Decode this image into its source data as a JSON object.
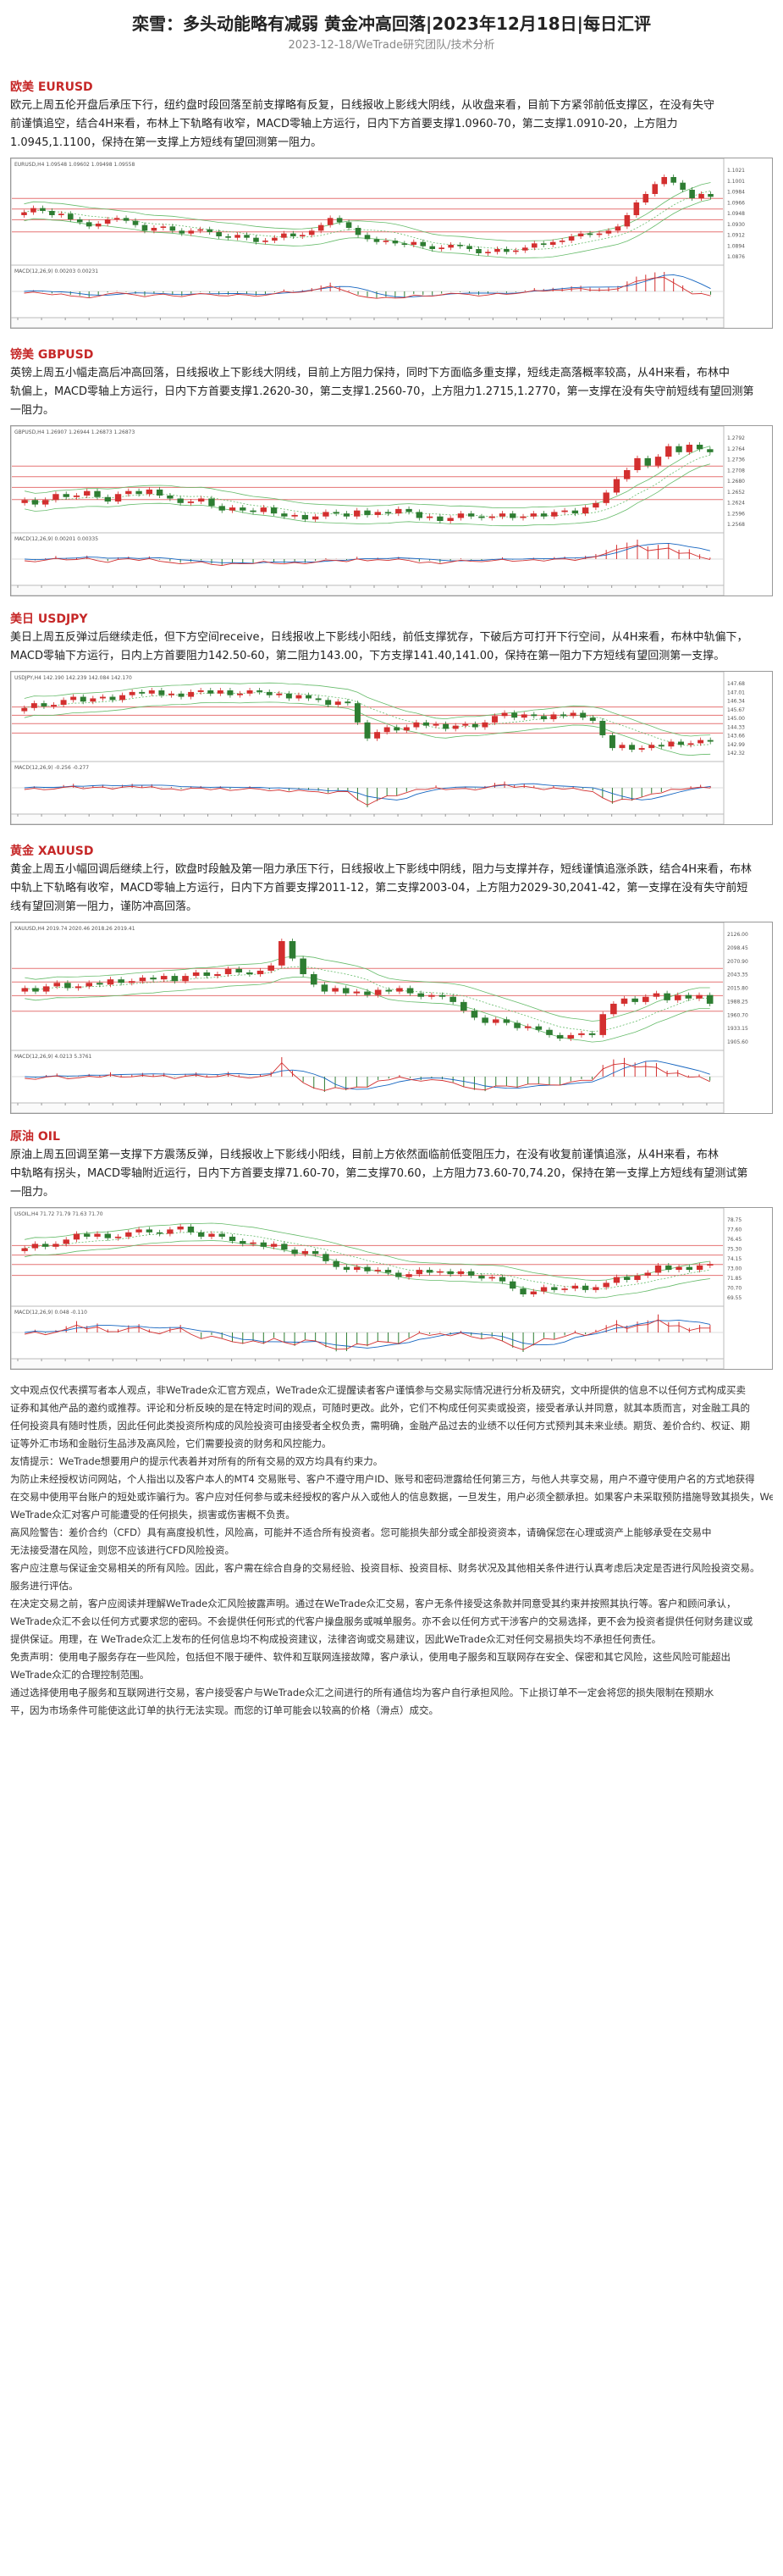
{
  "header": {
    "title": "栾雪：多头动能略有减弱 黄金冲高回落|2023年12月18日|每日汇评",
    "subtitle": "2023-12-18/WeTrade研究团队/技术分析"
  },
  "sections": [
    {
      "title": "欧美 EURUSD",
      "lines": [
        "欧元上周五伦开盘后承压下行，纽约盘时段回落至前支撑略有反复，日线报收上影线大阴线，从收盘来看，目前下方紧邻前低支撑区，在没有失守",
        "前谨慎追空，结合4H来看，布林上下轨略有收窄，MACD零轴上方运行，日内下方首要支撑1.0960-70，第二支撑1.0910-20，上方阻力",
        "1.0945,1.1100，保持在第一支撑上方短线有望回测第一阻力。"
      ],
      "chart_label": "EURUSD,H4 1.09548 1.09602 1.09498 1.09558",
      "macd_label": "MACD(12,26,9) 0.00203 0.00231",
      "price_ticks": [
        "1.1021",
        "1.1001",
        "1.0984",
        "1.0966",
        "1.0948",
        "1.0930",
        "1.0912",
        "1.0894",
        "1.0876"
      ],
      "candles": [
        2,
        3,
        -2,
        -3,
        1,
        -4,
        -2,
        -3,
        2,
        3,
        1,
        -2,
        -3,
        -4,
        2,
        1,
        -3,
        -2,
        2,
        1,
        -2,
        -3,
        -1,
        2,
        -2,
        -3,
        1,
        2,
        3,
        -2,
        1,
        3,
        4,
        5,
        -3,
        -4,
        -5,
        -3,
        -2,
        1,
        -2,
        -1,
        2,
        -3,
        -2,
        1,
        2,
        -1,
        -2,
        -3,
        1,
        2,
        -2,
        1,
        2,
        3,
        -1,
        2,
        1,
        3,
        2,
        -1,
        1,
        2,
        3,
        8,
        9,
        6,
        7,
        5,
        -4,
        -5,
        -6,
        3,
        -2
      ]
    },
    {
      "title": "镑美 GBPUSD",
      "lines": [
        "英镑上周五小幅走高后冲高回落，日线报收上下影线大阴线，目前上方阻力保持，同时下方面临多重支撑，短线走高落概率较高，从4H来看，布林中",
        "轨偏上，MACD零轴上方运行，日内下方首要支撑1.2620-30，第二支撑1.2560-70，上方阻力1.2715,1.2770，第一支撑在没有失守前短线有望回测第",
        "一阻力。"
      ],
      "chart_label": "GBPUSD,H4 1.26907 1.26944 1.26873 1.26873",
      "macd_label": "MACD(12,26,9) 0.00201 0.00335",
      "price_ticks": [
        "1.2792",
        "1.2764",
        "1.2736",
        "1.2708",
        "1.2680",
        "1.2652",
        "1.2624",
        "1.2596",
        "1.2568"
      ],
      "candles": [
        2,
        -3,
        3,
        4,
        -2,
        1,
        3,
        -4,
        -3,
        5,
        2,
        -2,
        3,
        -4,
        -2,
        -3,
        1,
        2,
        -5,
        -3,
        2,
        -2,
        -1,
        3,
        -4,
        -2,
        1,
        -3,
        2,
        3,
        -1,
        -2,
        4,
        -3,
        2,
        -1,
        3,
        -2,
        -4,
        1,
        -3,
        2,
        3,
        -2,
        -1,
        1,
        2,
        -3,
        1,
        2,
        -2,
        3,
        1,
        -2,
        4,
        3,
        7,
        9,
        6,
        8,
        -5,
        6,
        7,
        -4,
        5,
        -3,
        -2
      ]
    },
    {
      "title": "美日 USDJPY",
      "lines": [
        "美日上周五反弹过后继续走低，但下方空间receive，日线报收上下影线小阳线，前低支撑犹存，下破后方可打开下行空间，从4H来看，布林中轨偏下，",
        "MACD零轴下方运行，日内上方首要阻力142.50-60，第二阻力143.00，下方支撑141.40,141.00，保持在第一阻力下方短线有望回测第一支撑。"
      ],
      "chart_label": "USDJPY,H4 142.190 142.239 142.084 142.170",
      "macd_label": "MACD(12,26,9) -0.256 -0.277",
      "price_ticks": [
        "147.68",
        "147.01",
        "146.34",
        "145.67",
        "145.00",
        "144.33",
        "143.66",
        "142.99",
        "142.32"
      ],
      "candles": [
        2,
        3,
        -2,
        1,
        3,
        2,
        -3,
        2,
        1,
        -2,
        3,
        2,
        -1,
        2,
        -3,
        1,
        -2,
        3,
        1,
        -2,
        2,
        -3,
        1,
        2,
        -1,
        -2,
        1,
        -3,
        2,
        -2,
        -1,
        -3,
        2,
        -1,
        -12,
        -10,
        4,
        3,
        -2,
        2,
        3,
        -2,
        1,
        -3,
        2,
        1,
        -2,
        3,
        4,
        2,
        -3,
        2,
        -1,
        -2,
        3,
        -1,
        2,
        -3,
        -2,
        -9,
        -8,
        2,
        -3,
        1,
        2,
        -1,
        3,
        -2,
        1,
        2,
        -1
      ]
    },
    {
      "title": "黄金 XAUUSD",
      "lines": [
        "黄金上周五小幅回调后继续上行，欧盘时段触及第一阻力承压下行，日线报收上下影线中阴线，阻力与支撑并存，短线谨慎追涨杀跌，结合4H来看，布林",
        "中轨上下轨略有收窄，MACD零轴上方运行，日内下方首要支撑2011-12，第二支撑2003-04，上方阻力2029-30,2041-42，第一支撑在没有失守前短",
        "线有望回测第一阻力，谨防冲高回落。"
      ],
      "chart_label": "XAUUSD,H4 2019.74 2020.46 2018.26 2019.41",
      "macd_label": "MACD(12,26,9) 4.0213 5.3761",
      "price_ticks": [
        "2126.00",
        "2098.45",
        "2070.90",
        "2043.35",
        "2015.80",
        "1988.25",
        "1960.70",
        "1933.15",
        "1905.60"
      ],
      "candles": [
        2,
        -2,
        3,
        2,
        -3,
        1,
        2,
        -1,
        3,
        -2,
        1,
        2,
        -1,
        2,
        -3,
        3,
        2,
        -2,
        1,
        3,
        -2,
        -1,
        2,
        3,
        14,
        -10,
        -9,
        -6,
        -4,
        2,
        -3,
        1,
        -2,
        3,
        -1,
        2,
        -3,
        -2,
        1,
        -1,
        -3,
        -5,
        -4,
        -3,
        2,
        -2,
        -3,
        1,
        -2,
        -3,
        -2,
        2,
        1,
        -1,
        12,
        6,
        3,
        -2,
        3,
        2,
        -4,
        3,
        -2,
        2,
        -5
      ]
    },
    {
      "title": "原油 OIL",
      "lines": [
        "原油上周五回调至第一支撑下方震荡反弹，日线报收上下影线小阳线，目前上方依然面临前低变阻压力，在没有收复前谨慎追涨，从4H来看，布林",
        "中轨略有拐头，MACD零轴附近运行，日内下方首要支撑71.60-70，第二支撑70.60，上方阻力73.60-70,74.20，保持在第一支撑上方短线有望测试第",
        "一阻力。"
      ],
      "chart_label": "USOIL,H4 71.72 71.79 71.63 71.70",
      "macd_label": "MACD(12,26,9) 0.048 -0.110",
      "price_ticks": [
        "78.75",
        "77.60",
        "76.45",
        "75.30",
        "74.15",
        "73.00",
        "71.85",
        "70.70",
        "69.55"
      ],
      "candles": [
        2,
        3,
        -2,
        2,
        3,
        4,
        -2,
        2,
        -3,
        1,
        3,
        2,
        -2,
        -1,
        3,
        2,
        -4,
        -3,
        2,
        -2,
        -3,
        -2,
        1,
        -3,
        2,
        -4,
        -3,
        2,
        -2,
        -5,
        -4,
        -2,
        2,
        -3,
        1,
        -2,
        -3,
        2,
        3,
        -2,
        1,
        -2,
        2,
        -3,
        -2,
        1,
        -3,
        -5,
        -4,
        2,
        3,
        -2,
        1,
        2,
        -3,
        2,
        3,
        4,
        -2,
        3,
        2,
        5,
        -3,
        2,
        -2,
        3,
        1
      ]
    }
  ],
  "footer": {
    "lines": [
      "文中观点仅代表撰写者本人观点，非WeTrade众汇官方观点，WeTrade众汇提醒读者客户谨慎参与交易实际情况进行分析及研究，文中所提供的信息不以任何方式构成买卖",
      "证券和其他产品的邀约或推荐。评论和分析反映的是在特定时间的观点，可随时更改。此外，它们不构成任何买卖或投资，接受者承认并同意，就其本质而言，对金融工具的",
      "任何投资具有随时性质，因此任何此类投资所构成的风险投资可由接受者全权负责，需明确，金融产品过去的业绩不以任何方式预判其未来业绩。期货、差价合约、权证、期",
      "证等外汇市场和金融衍生品涉及高风险，它们需要投资的财务和风控能力。",
      "友情提示：WeTrade想要用户的提示代表着并对所有的所有交易的双方均具有约束力。",
      "为防止未经授权访问网站，个人指出以及客户本人的MT4 交易账号、客户不遵守用户ID、账号和密码泄露给任何第三方，与他人共享交易，用户不遵守使用户名的方式地获得",
      "在交易中使用平台账户的短处或诈骗行为。客户应对任何参与或未经授权的客户从入或他人的信息数据，一旦发生，用户必须全额承担。如果客户未采取预防措施导致其损失，WeTrade众汇",
      "WeTrade众汇对客户可能遭受的任何损失，损害或伤害概不负责。",
      "高风险警告：差价合约（CFD）具有高度投机性，风险高，可能并不适合所有投资者。您可能损失部分或全部投资资本，请确保您在心理或资产上能够承受在交易中",
      "无法接受潜在风险，则您不应该进行CFD风险投资。",
      "客户应注意与保证金交易相关的所有风险。因此，客户需在综合自身的交易经验、投资目标、投资目标、财务状况及其他相关条件进行认真考虑后决定是否进行风险投资交易。",
      "服务进行评估。",
      "在决定交易之前，客户应阅读并理解WeTrade众汇风险披露声明。通过在WeTrade众汇交易，客户无条件接受这条款并同意受其约束并按照其执行等。客户和顾问承认，",
      "WeTrade众汇不会以任何方式要求您的密码。不会提供任何形式的代客户操盘服务或喊单服务。亦不会以任何方式干涉客户的交易选择，更不会为投资者提供任何财务建议或",
      "提供保证。用理，在 WeTrade众汇上发布的任何信息均不构成投资建议，法律咨询或交易建议，因此WeTrade众汇对任何交易损失均不承担任何责任。",
      "免责声明：使用电子服务存在一些风险，包括但不限于硬件、软件和互联网连接故障，客户承认，使用电子服务和互联网存在安全、保密和其它风险，这些风险可能超出",
      "WeTrade众汇的合理控制范围。",
      "通过选择使用电子服务和互联网进行交易，客户接受客户与WeTrade众汇之间进行的所有通信均为客户自行承担风险。下止损订单不一定会将您的损失限制在预期水",
      "平，因为市场条件可能使这此订单的执行无法实现。而您的订单可能会以较高的价格（滑点）成交。"
    ]
  },
  "colors": {
    "accent": "#c62828",
    "bull": "#d32f2f",
    "bear": "#2e7d32",
    "hline": "#e57373",
    "band": "#66bb6a",
    "macd_blue": "#1565c0"
  }
}
